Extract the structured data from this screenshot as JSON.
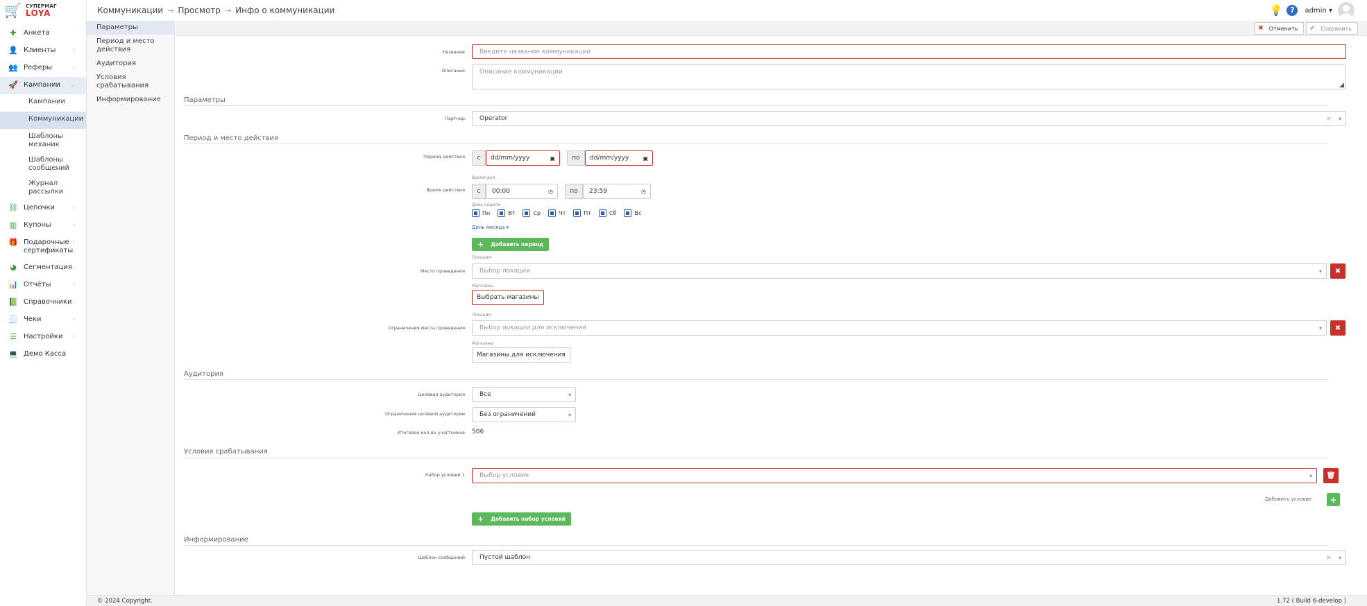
{
  "logo": {
    "top": "СУПЕРМАГ",
    "bottom": "LOYA"
  },
  "header": {
    "breadcrumb": [
      "Коммуникации",
      "Просмотр",
      "Инфо о коммуникации"
    ],
    "user": "admin"
  },
  "sidebar": {
    "items": [
      {
        "label": "Анкета",
        "icon": "plus-icon"
      },
      {
        "label": "Клиенты",
        "icon": "user-icon"
      },
      {
        "label": "Реферы",
        "icon": "users-icon"
      },
      {
        "label": "Кампании",
        "icon": "rocket-icon"
      },
      {
        "label": "Цепочки",
        "icon": "chain-icon"
      },
      {
        "label": "Купоны",
        "icon": "barcode-icon"
      },
      {
        "label": "Подарочные сертификаты",
        "icon": "gift-icon"
      },
      {
        "label": "Сегментация",
        "icon": "pie-icon"
      },
      {
        "label": "Отчёты",
        "icon": "chart-icon"
      },
      {
        "label": "Справочники",
        "icon": "book-icon"
      },
      {
        "label": "Чеки",
        "icon": "receipt-icon"
      },
      {
        "label": "Настройки",
        "icon": "sliders-icon"
      },
      {
        "label": "Демо Касса",
        "icon": "laptop-icon"
      }
    ],
    "campaign_sub": [
      "Кампании",
      "Коммуникации",
      "Шаблоны механик",
      "Шаблоны сообщений",
      "Журнал рассылки"
    ]
  },
  "secnav": [
    "Параметры",
    "Период и место действия",
    "Аудитория",
    "Условия срабатывания",
    "Информирование"
  ],
  "actions": {
    "cancel": "Отменить",
    "save": "Сохранить"
  },
  "form": {
    "name_label": "Название",
    "name_placeholder": "Введите название коммуникации",
    "desc_label": "Описание",
    "desc_placeholder": "Описание коммуникации",
    "sec_params": "Параметры",
    "partner_label": "Партнер",
    "partner_value": "Operator",
    "sec_period": "Период и место действия",
    "period_label": "Период действия",
    "from": "с",
    "to": "по",
    "date_placeholder": "dd/mm/yyyy",
    "time_label": "Время действия",
    "time_of_day": "Время дня",
    "time_from": "00:00",
    "time_to": "23:59",
    "weekday_label": "День недели",
    "days": [
      "Пн",
      "Вт",
      "Ср",
      "Чт",
      "Пт",
      "Сб",
      "Вс"
    ],
    "month_day_link": "День месяца",
    "add_period": "Добавить период",
    "place_label": "Место проведения",
    "location_small": "Локация",
    "location_placeholder": "Выбор локации",
    "shops_small": "Магазины",
    "choose_shops": "Выбрать магазины",
    "restrict_label": "Ограничения места проведения",
    "exclude_location_placeholder": "Выбор локации для исключения",
    "exclude_shops": "Магазины для исключения",
    "sec_audience": "Аудитория",
    "target_label": "Целевая аудитория",
    "target_value": "Все",
    "restrict_aud_label": "Ограничения целевой аудитории",
    "restrict_aud_value": "Без ограничений",
    "total_label": "Итоговое кол-во участников",
    "total_value": "506",
    "sec_conditions": "Условия срабатывания",
    "condset_label": "Набор условий 1",
    "condition_placeholder": "Выбор условия",
    "add_condition": "Добавить условие",
    "add_condset": "Добавить набор условий",
    "sec_inform": "Информирование",
    "template_label": "Шаблон сообщений",
    "template_value": "Пустой шаблон"
  },
  "footer": {
    "copyright": "© 2024 Copyright.",
    "version": "1.72 ( Build 6-develop )"
  }
}
